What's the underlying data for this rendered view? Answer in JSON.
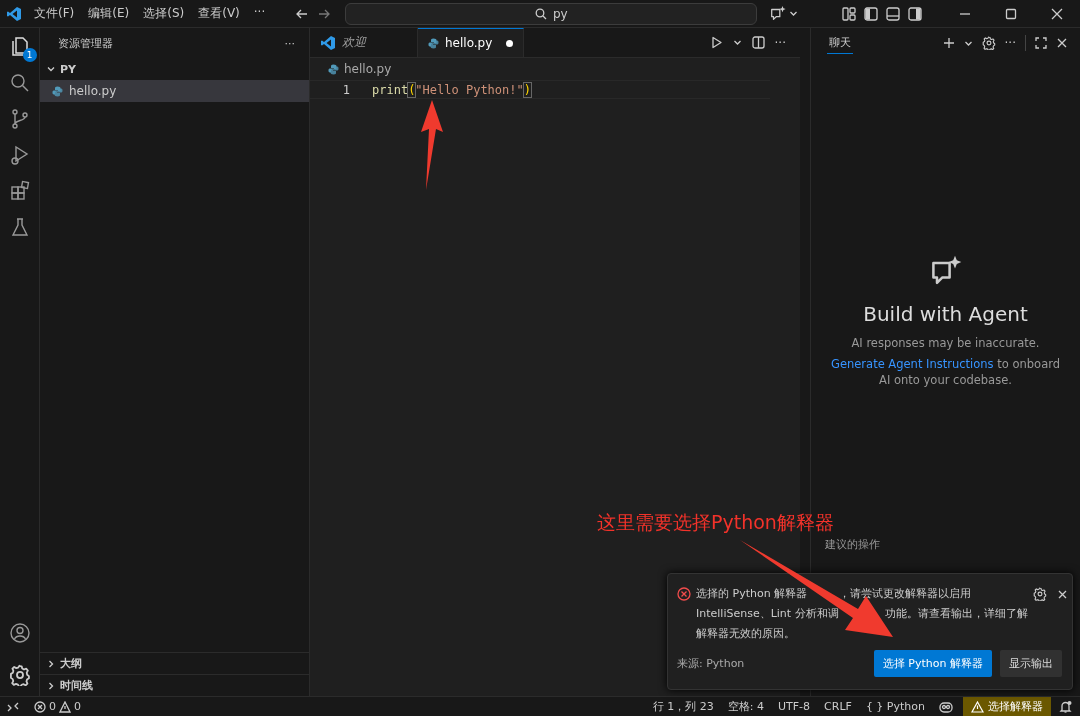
{
  "menu": [
    "文件(F)",
    "编辑(E)",
    "选择(S)",
    "查看(V)",
    "···"
  ],
  "search": {
    "value": "py"
  },
  "activity_bar": {
    "explorer_badge": "1"
  },
  "sidebar": {
    "title": "资源管理器",
    "more": "···",
    "folder": {
      "label": "PY",
      "expanded": true,
      "children": [
        {
          "label": "hello.py",
          "selected": true
        }
      ]
    },
    "sections": [
      {
        "label": "大纲",
        "expanded": false
      },
      {
        "label": "时间线",
        "expanded": false
      }
    ]
  },
  "tabs": [
    {
      "label": "欢迎",
      "kind": "welcome",
      "selected": false,
      "dirty": false
    },
    {
      "label": "hello.py",
      "kind": "python",
      "selected": true,
      "dirty": true
    }
  ],
  "editor_more": "···",
  "breadcrumb": "hello.py",
  "editor": {
    "lines": [
      {
        "number": "1",
        "tokens": [
          {
            "text": "print",
            "kind": "function"
          },
          {
            "text": "(",
            "kind": "bracket"
          },
          {
            "text": "\"Hello Python!\"",
            "kind": "string"
          },
          {
            "text": ")",
            "kind": "bracket"
          }
        ]
      }
    ]
  },
  "chat": {
    "tab": "聊天",
    "more": "···",
    "title": "Build with Agent",
    "subtitle": "AI responses may be inaccurate.",
    "link": "Generate Agent Instructions",
    "link_rest": " to onboard AI onto your codebase.",
    "suggested_label": "建议的操作"
  },
  "notification": {
    "error": true,
    "message_lines": [
      [
        "选择的 Python 解释器",
        "，请尝试更改解释器以启用"
      ],
      [
        "IntelliSense、Lint 分析和调",
        "功能。请查看输出，详细了解"
      ],
      [
        "解释器无效的原因。"
      ]
    ],
    "source": "来源: Python",
    "buttons": [
      {
        "label": "选择 Python 解释器",
        "primary": true
      },
      {
        "label": "显示输出",
        "primary": false
      }
    ]
  },
  "status_bar": {
    "errors": "0",
    "warnings": "0",
    "items": [
      "行 1，列 23",
      "空格: 4",
      "UTF-8",
      "CRLF",
      "{ } Python"
    ],
    "interpreter": "选择解释器"
  },
  "annotation": {
    "text": "这里需要选择Python解释器"
  }
}
